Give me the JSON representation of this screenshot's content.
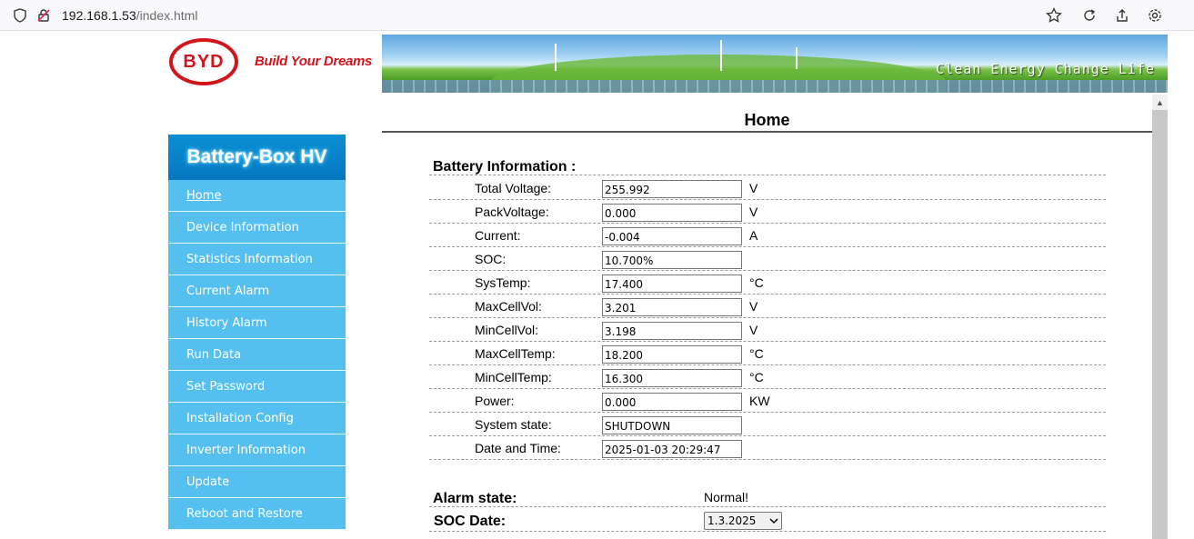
{
  "browser": {
    "url_host": "192.168.1.53",
    "url_path": "/index.html"
  },
  "header": {
    "logo_text": "BYD",
    "tagline": "Build Your Dreams",
    "banner_text": "Clean Energy Change Life"
  },
  "sidebar": {
    "title": "Battery-Box HV",
    "items": [
      {
        "label": "Home"
      },
      {
        "label": "Device Information"
      },
      {
        "label": "Statistics Information"
      },
      {
        "label": "Current Alarm"
      },
      {
        "label": "History Alarm"
      },
      {
        "label": "Run Data"
      },
      {
        "label": "Set Password"
      },
      {
        "label": "Installation Config"
      },
      {
        "label": "Inverter Information"
      },
      {
        "label": "Update"
      },
      {
        "label": "Reboot and Restore"
      }
    ]
  },
  "main": {
    "title": "Home",
    "battery_heading": "Battery Information :",
    "rows": [
      {
        "label": "Total Voltage:",
        "value": "255.992",
        "unit": "V"
      },
      {
        "label": "PackVoltage:",
        "value": "0.000",
        "unit": "V"
      },
      {
        "label": "Current:",
        "value": "-0.004",
        "unit": "A"
      },
      {
        "label": "SOC:",
        "value": "10.700%",
        "unit": ""
      },
      {
        "label": "SysTemp:",
        "value": "17.400",
        "unit": "°C"
      },
      {
        "label": "MaxCellVol:",
        "value": "3.201",
        "unit": "V"
      },
      {
        "label": "MinCellVol:",
        "value": "3.198",
        "unit": "V"
      },
      {
        "label": "MaxCellTemp:",
        "value": "18.200",
        "unit": "°C"
      },
      {
        "label": "MinCellTemp:",
        "value": "16.300",
        "unit": "°C"
      },
      {
        "label": "Power:",
        "value": "0.000",
        "unit": "KW"
      },
      {
        "label": "System state:",
        "value": "SHUTDOWN",
        "unit": ""
      },
      {
        "label": "Date and Time:",
        "value": "2025-01-03 20:29:47",
        "unit": ""
      }
    ],
    "alarm_label": "Alarm state:",
    "alarm_value": "Normal!",
    "soc_date_label": "SOC Date:",
    "soc_date_value": "1.3.2025"
  }
}
